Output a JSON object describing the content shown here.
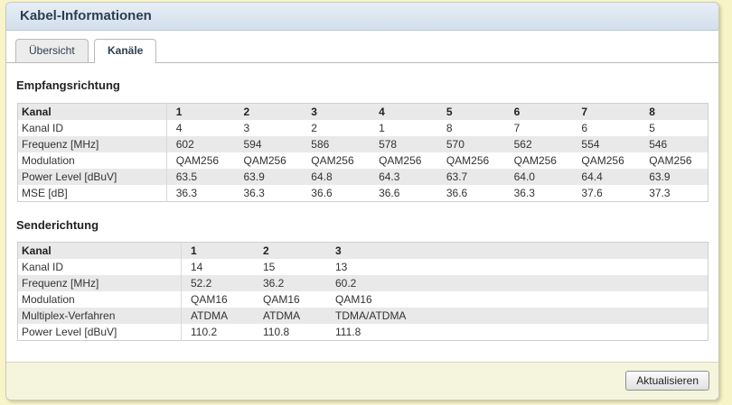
{
  "panel": {
    "title": "Kabel-Informationen"
  },
  "tabs": [
    {
      "label": "Übersicht",
      "active": false
    },
    {
      "label": "Kanäle",
      "active": true
    }
  ],
  "downstream": {
    "title": "Empfangsrichtung",
    "header": {
      "label": "Kanal",
      "channels": [
        "1",
        "2",
        "3",
        "4",
        "5",
        "6",
        "7",
        "8"
      ]
    },
    "rows": [
      {
        "label": "Kanal ID",
        "values": [
          "4",
          "3",
          "2",
          "1",
          "8",
          "7",
          "6",
          "5"
        ]
      },
      {
        "label": "Frequenz [MHz]",
        "values": [
          "602",
          "594",
          "586",
          "578",
          "570",
          "562",
          "554",
          "546"
        ]
      },
      {
        "label": "Modulation",
        "values": [
          "QAM256",
          "QAM256",
          "QAM256",
          "QAM256",
          "QAM256",
          "QAM256",
          "QAM256",
          "QAM256"
        ]
      },
      {
        "label": "Power Level [dBuV]",
        "values": [
          "63.5",
          "63.9",
          "64.8",
          "64.3",
          "63.7",
          "64.0",
          "64.4",
          "63.9"
        ]
      },
      {
        "label": "MSE [dB]",
        "values": [
          "36.3",
          "36.3",
          "36.6",
          "36.6",
          "36.6",
          "36.3",
          "37.6",
          "37.3"
        ]
      }
    ]
  },
  "upstream": {
    "title": "Senderichtung",
    "header": {
      "label": "Kanal",
      "channels": [
        "1",
        "2",
        "3"
      ]
    },
    "rows": [
      {
        "label": "Kanal ID",
        "values": [
          "14",
          "15",
          "13"
        ]
      },
      {
        "label": "Frequenz [MHz]",
        "values": [
          "52.2",
          "36.2",
          "60.2"
        ]
      },
      {
        "label": "Modulation",
        "values": [
          "QAM16",
          "QAM16",
          "QAM16"
        ]
      },
      {
        "label": "Multiplex-Verfahren",
        "values": [
          "ATDMA",
          "ATDMA",
          "TDMA/ATDMA"
        ]
      },
      {
        "label": "Power Level [dBuV]",
        "values": [
          "110.2",
          "110.8",
          "111.8"
        ]
      }
    ]
  },
  "footer": {
    "refresh_label": "Aktualisieren"
  }
}
